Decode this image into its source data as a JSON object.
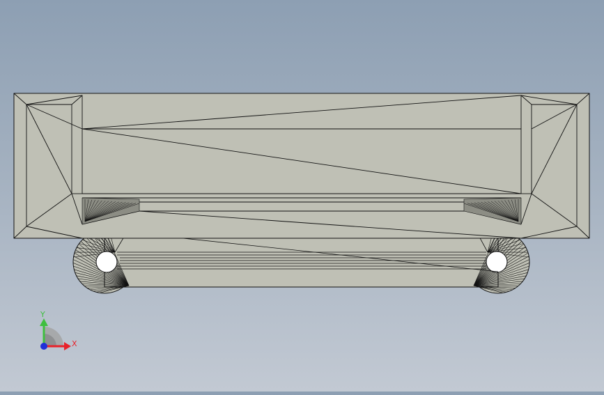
{
  "axis_triad": {
    "x_label": "X",
    "y_label": "Y",
    "x_color": "#e8222a",
    "y_color": "#3fbf3f",
    "z_color": "#1f2fd8"
  },
  "model": {
    "face_color": "#bfc0b5",
    "shadow_face_color": "#a9aa9f",
    "edge_color": "#111111"
  }
}
